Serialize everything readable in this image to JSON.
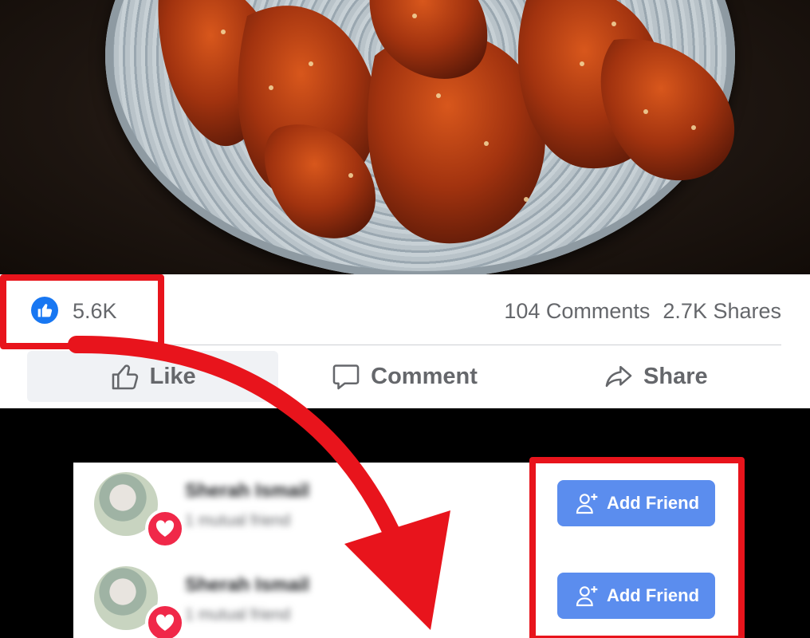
{
  "post": {
    "reactions": {
      "count": "5.6K"
    },
    "stats": {
      "comments": "104 Comments",
      "shares": "2.7K Shares"
    },
    "actions": {
      "like": "Like",
      "comment": "Comment",
      "share": "Share"
    }
  },
  "friends": [
    {
      "name": "Sherah Ismail",
      "mutual": "1 mutual friend",
      "button": "Add Friend"
    },
    {
      "name": "Sherah Ismail",
      "mutual": "1 mutual friend",
      "button": "Add Friend"
    }
  ],
  "colors": {
    "facebook_blue": "#1877f2",
    "add_friend_button": "#5b8dee",
    "heart_reaction": "#f02849",
    "annotation_red": "#e8141c",
    "secondary_text": "#65676b"
  },
  "icons": [
    "like-reaction-icon",
    "thumbs-up-icon",
    "comment-icon",
    "share-icon",
    "heart-reaction-icon",
    "add-friend-icon"
  ]
}
